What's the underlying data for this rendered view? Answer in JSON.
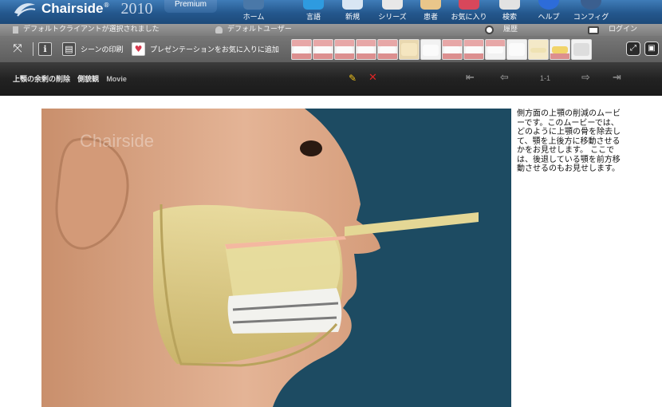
{
  "app": {
    "logo_text": "Chairside",
    "logo_year": "2010",
    "edition": "Premium"
  },
  "nav": [
    {
      "label": "ホーム",
      "icon": "home-icon",
      "color": "#4a78a8"
    },
    {
      "label": "言語",
      "icon": "language-icon",
      "color": "#2e9be0"
    },
    {
      "label": "新規",
      "icon": "new-icon",
      "color": "#d9e6f3"
    },
    {
      "label": "シリーズ",
      "icon": "series-icon",
      "color": "#e8e8e8"
    },
    {
      "label": "患者",
      "icon": "patient-icon",
      "color": "#e9c68a"
    },
    {
      "label": "お気に入り",
      "icon": "favorites-icon",
      "color": "#d8475b"
    },
    {
      "label": "検索",
      "icon": "search-icon",
      "color": "#e2e2e2"
    },
    {
      "label": "ヘルプ",
      "icon": "help-icon",
      "color": "#2d6cd9"
    },
    {
      "label": "コンフィグ",
      "icon": "config-icon",
      "color": "#3b5f8f"
    }
  ],
  "status": {
    "client": "デフォルトクライアントが選択されました",
    "user": "デフォルトユーザー",
    "history": "履歴",
    "login": "ログイン"
  },
  "toolbar": {
    "print_label": "シーンの印刷",
    "favorite_label": "プレゼンテーションをお気に入りに追加"
  },
  "presentation": {
    "title": "上顎の余剰の削除",
    "view": "側貌観",
    "type": "Movie",
    "page": "1-1"
  },
  "media": {
    "watermark": "Chairside"
  },
  "description": "側方面の上顎の削減のムービーです。このムービーでは、どのように上顎の骨を除去して、顎を上後方に移動させるかをお見せします。 ここでは、後退している顎を前方移動させるのもお見せします。",
  "colors": {
    "header_blue": "#24578d",
    "media_background": "#1d4b62",
    "edit": "#f0c21c",
    "delete": "#e02525"
  }
}
